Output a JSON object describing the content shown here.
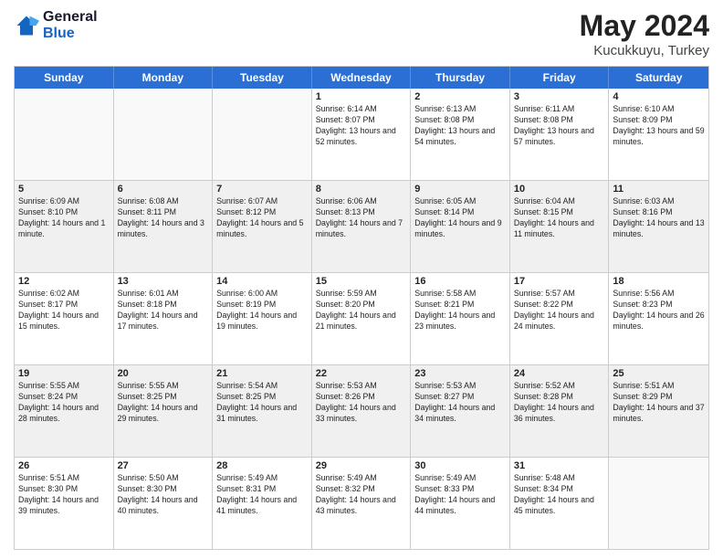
{
  "header": {
    "logo_general": "General",
    "logo_blue": "Blue",
    "title": "May 2024",
    "location": "Kucukkuyu, Turkey"
  },
  "days_of_week": [
    "Sunday",
    "Monday",
    "Tuesday",
    "Wednesday",
    "Thursday",
    "Friday",
    "Saturday"
  ],
  "weeks": [
    [
      {
        "day": "",
        "empty": true
      },
      {
        "day": "",
        "empty": true
      },
      {
        "day": "",
        "empty": true
      },
      {
        "day": "1",
        "sunrise": "6:14 AM",
        "sunset": "8:07 PM",
        "daylight": "13 hours and 52 minutes."
      },
      {
        "day": "2",
        "sunrise": "6:13 AM",
        "sunset": "8:08 PM",
        "daylight": "13 hours and 54 minutes."
      },
      {
        "day": "3",
        "sunrise": "6:11 AM",
        "sunset": "8:08 PM",
        "daylight": "13 hours and 57 minutes."
      },
      {
        "day": "4",
        "sunrise": "6:10 AM",
        "sunset": "8:09 PM",
        "daylight": "13 hours and 59 minutes."
      }
    ],
    [
      {
        "day": "5",
        "sunrise": "6:09 AM",
        "sunset": "8:10 PM",
        "daylight": "14 hours and 1 minute."
      },
      {
        "day": "6",
        "sunrise": "6:08 AM",
        "sunset": "8:11 PM",
        "daylight": "14 hours and 3 minutes."
      },
      {
        "day": "7",
        "sunrise": "6:07 AM",
        "sunset": "8:12 PM",
        "daylight": "14 hours and 5 minutes."
      },
      {
        "day": "8",
        "sunrise": "6:06 AM",
        "sunset": "8:13 PM",
        "daylight": "14 hours and 7 minutes."
      },
      {
        "day": "9",
        "sunrise": "6:05 AM",
        "sunset": "8:14 PM",
        "daylight": "14 hours and 9 minutes."
      },
      {
        "day": "10",
        "sunrise": "6:04 AM",
        "sunset": "8:15 PM",
        "daylight": "14 hours and 11 minutes."
      },
      {
        "day": "11",
        "sunrise": "6:03 AM",
        "sunset": "8:16 PM",
        "daylight": "14 hours and 13 minutes."
      }
    ],
    [
      {
        "day": "12",
        "sunrise": "6:02 AM",
        "sunset": "8:17 PM",
        "daylight": "14 hours and 15 minutes."
      },
      {
        "day": "13",
        "sunrise": "6:01 AM",
        "sunset": "8:18 PM",
        "daylight": "14 hours and 17 minutes."
      },
      {
        "day": "14",
        "sunrise": "6:00 AM",
        "sunset": "8:19 PM",
        "daylight": "14 hours and 19 minutes."
      },
      {
        "day": "15",
        "sunrise": "5:59 AM",
        "sunset": "8:20 PM",
        "daylight": "14 hours and 21 minutes."
      },
      {
        "day": "16",
        "sunrise": "5:58 AM",
        "sunset": "8:21 PM",
        "daylight": "14 hours and 23 minutes."
      },
      {
        "day": "17",
        "sunrise": "5:57 AM",
        "sunset": "8:22 PM",
        "daylight": "14 hours and 24 minutes."
      },
      {
        "day": "18",
        "sunrise": "5:56 AM",
        "sunset": "8:23 PM",
        "daylight": "14 hours and 26 minutes."
      }
    ],
    [
      {
        "day": "19",
        "sunrise": "5:55 AM",
        "sunset": "8:24 PM",
        "daylight": "14 hours and 28 minutes."
      },
      {
        "day": "20",
        "sunrise": "5:55 AM",
        "sunset": "8:25 PM",
        "daylight": "14 hours and 29 minutes."
      },
      {
        "day": "21",
        "sunrise": "5:54 AM",
        "sunset": "8:25 PM",
        "daylight": "14 hours and 31 minutes."
      },
      {
        "day": "22",
        "sunrise": "5:53 AM",
        "sunset": "8:26 PM",
        "daylight": "14 hours and 33 minutes."
      },
      {
        "day": "23",
        "sunrise": "5:53 AM",
        "sunset": "8:27 PM",
        "daylight": "14 hours and 34 minutes."
      },
      {
        "day": "24",
        "sunrise": "5:52 AM",
        "sunset": "8:28 PM",
        "daylight": "14 hours and 36 minutes."
      },
      {
        "day": "25",
        "sunrise": "5:51 AM",
        "sunset": "8:29 PM",
        "daylight": "14 hours and 37 minutes."
      }
    ],
    [
      {
        "day": "26",
        "sunrise": "5:51 AM",
        "sunset": "8:30 PM",
        "daylight": "14 hours and 39 minutes."
      },
      {
        "day": "27",
        "sunrise": "5:50 AM",
        "sunset": "8:30 PM",
        "daylight": "14 hours and 40 minutes."
      },
      {
        "day": "28",
        "sunrise": "5:49 AM",
        "sunset": "8:31 PM",
        "daylight": "14 hours and 41 minutes."
      },
      {
        "day": "29",
        "sunrise": "5:49 AM",
        "sunset": "8:32 PM",
        "daylight": "14 hours and 43 minutes."
      },
      {
        "day": "30",
        "sunrise": "5:49 AM",
        "sunset": "8:33 PM",
        "daylight": "14 hours and 44 minutes."
      },
      {
        "day": "31",
        "sunrise": "5:48 AM",
        "sunset": "8:34 PM",
        "daylight": "14 hours and 45 minutes."
      },
      {
        "day": "",
        "empty": true
      }
    ]
  ],
  "labels": {
    "sunrise_prefix": "Sunrise: ",
    "sunset_prefix": "Sunset: ",
    "daylight_prefix": "Daylight: "
  }
}
